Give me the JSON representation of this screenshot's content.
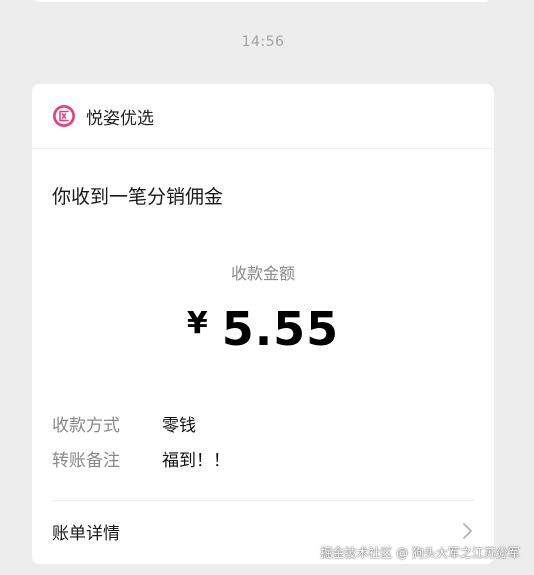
{
  "colors": {
    "background": "#ededed",
    "card": "#ffffff",
    "brand_pink": "#e7407f",
    "muted_text": "#8a8a8a"
  },
  "timestamp": "14:56",
  "card": {
    "brand": {
      "name": "悦姿优选",
      "logo_icon": "brand-logo-icon"
    },
    "title": "你收到一笔分销佣金",
    "amount": {
      "label": "收款金额",
      "currency_symbol": "¥",
      "value": "5.55"
    },
    "info": [
      {
        "key": "收款方式",
        "value": "零钱"
      },
      {
        "key": "转账备注",
        "value": "福到！！"
      }
    ],
    "detail_link": {
      "label": "账单详情",
      "icon": "chevron-right-icon"
    }
  },
  "watermark": "掘金技术社区 @ 狗头大军之江苏分军"
}
